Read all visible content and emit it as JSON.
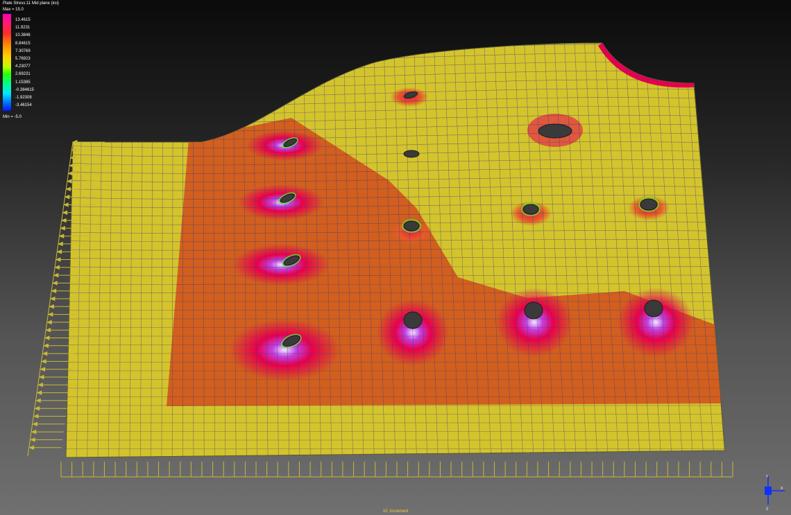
{
  "legend": {
    "title": "Plate Stress:11 Mid plane (ksi)",
    "max_label": "Max = 15.0",
    "min_label": "Min = -5.0",
    "ticks": [
      "13.4615",
      "11.9231",
      "10.3846",
      "8.84615",
      "7.30769",
      "5.76923",
      "4.23077",
      "2.69231",
      "1.15385",
      "-0.384615",
      "-1.92308",
      "-3.46154"
    ],
    "gradient_colors": [
      "#ff00b8",
      "#ff1a6e",
      "#ff2a2a",
      "#ff8a00",
      "#ffd400",
      "#b8ff00",
      "#2aff00",
      "#00ff8c",
      "#00e8ff",
      "#0078ff",
      "#0018ff"
    ]
  },
  "status": {
    "increment": "10: Increment"
  },
  "axes": {
    "labels": [
      "Y",
      "X",
      "Z"
    ]
  },
  "colors": {
    "plate_base": "#d4c42c",
    "stress_band": "#d25a1e",
    "hot_spot": "#e8004c",
    "peak": "#c040e0",
    "mesh_line": "#3a3a80",
    "load_arrow": "#c8b838",
    "triad_blue": "#1030ff"
  }
}
